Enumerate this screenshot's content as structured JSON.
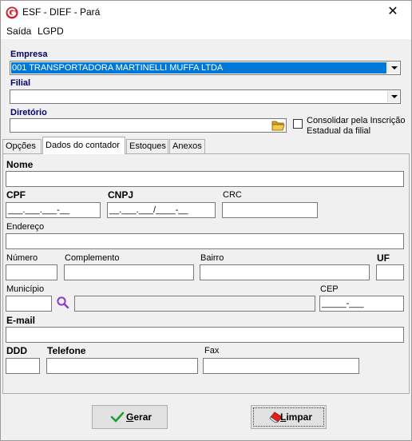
{
  "window": {
    "title": "ESF - DIEF - Pará",
    "close": "✕"
  },
  "menu": {
    "items": [
      "Saída",
      "LGPD"
    ]
  },
  "empresa": {
    "label": "Empresa",
    "value": "001 TRANSPORTADORA MARTINELLI MUFFA LTDA"
  },
  "filial": {
    "label": "Filial",
    "value": ""
  },
  "diretorio": {
    "label": "Diretório",
    "value": ""
  },
  "consolidar": {
    "line1": "Consolidar pela Inscrição",
    "line2": "Estadual da filial",
    "checked": false
  },
  "tabs": [
    {
      "label": "Opções",
      "active": false
    },
    {
      "label": "Dados do contador",
      "active": true
    },
    {
      "label": "Estoques",
      "active": false
    },
    {
      "label": "Anexos",
      "active": false
    }
  ],
  "form": {
    "nome": {
      "label": "Nome",
      "value": ""
    },
    "cpf": {
      "label": "CPF",
      "mask": "___.___.___-__"
    },
    "cnpj": {
      "label": "CNPJ",
      "mask": "__.___.___/____-__"
    },
    "crc": {
      "label": "CRC",
      "value": ""
    },
    "endereco": {
      "label": "Endereço",
      "value": ""
    },
    "numero": {
      "label": "Número",
      "value": ""
    },
    "complemento": {
      "label": "Complemento",
      "value": ""
    },
    "bairro": {
      "label": "Bairro",
      "value": ""
    },
    "uf": {
      "label": "UF",
      "value": ""
    },
    "municipio": {
      "label": "Município",
      "code": "",
      "name": ""
    },
    "cep": {
      "label": "CEP",
      "mask": "_____-___"
    },
    "email": {
      "label": "E-mail",
      "value": ""
    },
    "ddd": {
      "label": "DDD",
      "value": ""
    },
    "telefone": {
      "label": "Telefone",
      "value": ""
    },
    "fax": {
      "label": "Fax",
      "value": ""
    }
  },
  "buttons": {
    "gerar": {
      "prefix": "",
      "accel": "G",
      "rest": "erar"
    },
    "limpar": {
      "prefix": "",
      "accel": "L",
      "rest": "impar"
    }
  },
  "colors": {
    "selection": "#0078d7",
    "label_blue": "#000066",
    "app_icon": "#d0202a",
    "check_green": "#1e9e3a",
    "eraser_red": "#e02020"
  }
}
